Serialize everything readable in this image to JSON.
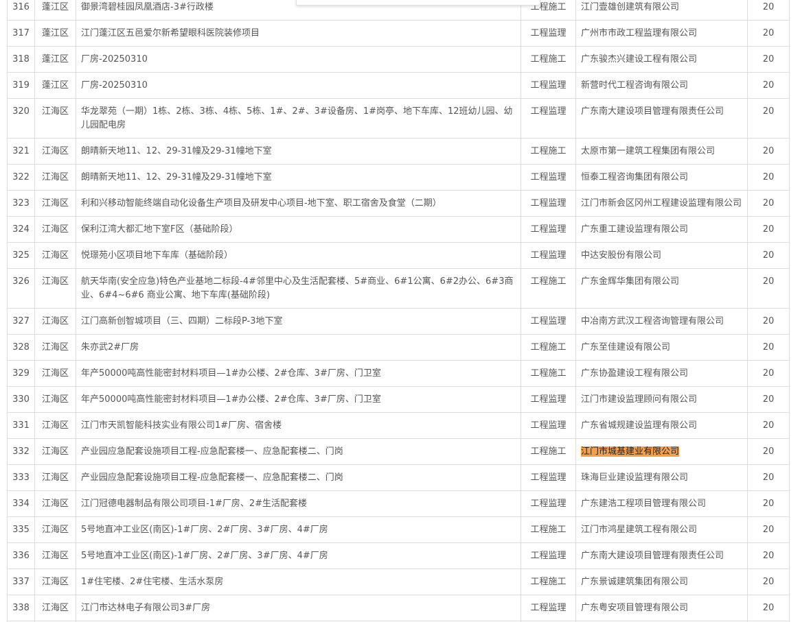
{
  "table": {
    "rows": [
      {
        "num": "316",
        "district": "蓬江区",
        "project": "御景湾碧桂园凤凰酒店-3#行政楼",
        "type": "工程施工",
        "company": "江门壹雄创建筑有限公司",
        "score": "20"
      },
      {
        "num": "317",
        "district": "蓬江区",
        "project": "江门蓬江区五邑爱尔新希望眼科医院装修项目",
        "type": "工程监理",
        "company": "广州市市政工程监理有限公司",
        "score": "20"
      },
      {
        "num": "318",
        "district": "蓬江区",
        "project": "厂房-20250310",
        "type": "工程施工",
        "company": "广东骏杰兴建设工程有限公司",
        "score": "20"
      },
      {
        "num": "319",
        "district": "蓬江区",
        "project": "厂房-20250310",
        "type": "工程监理",
        "company": "新营时代工程咨询有限公司",
        "score": "20"
      },
      {
        "num": "320",
        "district": "江海区",
        "project": "华龙翠苑（一期）1栋、2栋、3栋、4栋、5栋、1#、2#、3#设备房、1#岗亭、地下车库、12班幼儿园、幼儿园配电房",
        "type": "工程监理",
        "company": "广东南大建设项目管理有限责任公司",
        "score": "20"
      },
      {
        "num": "321",
        "district": "江海区",
        "project": "朗晴新天地11、12、29-31幢及29-31幢地下室",
        "type": "工程施工",
        "company": "太原市第一建筑工程集团有限公司",
        "score": "20"
      },
      {
        "num": "322",
        "district": "江海区",
        "project": "朗晴新天地11、12、29-31幢及29-31幢地下室",
        "type": "工程监理",
        "company": "恒泰工程咨询集团有限公司",
        "score": "20"
      },
      {
        "num": "323",
        "district": "江海区",
        "project": "利和兴移动智能终端自动化设备生产项目及研发中心项目-地下室、职工宿舍及食堂（二期）",
        "type": "工程监理",
        "company": "江门市新会区冈州工程建设监理有限公司",
        "score": "20"
      },
      {
        "num": "324",
        "district": "江海区",
        "project": "保利江湾大都汇地下室F区（基础阶段）",
        "type": "工程监理",
        "company": "广东重工建设监理有限公司",
        "score": "20"
      },
      {
        "num": "325",
        "district": "江海区",
        "project": "悦璟苑小区项目地下车库（基础阶段）",
        "type": "工程监理",
        "company": "中达安股份有限公司",
        "score": "20"
      },
      {
        "num": "326",
        "district": "江海区",
        "project": "航天华南(安全应急)特色产业基地二标段-4#邻里中心及生活配套楼、5#商业、6#1公寓、6#2办公、6#3商业、6#4~6#6 商业公寓、地下车库(基础阶段)",
        "type": "工程施工",
        "company": "广东金辉华集团有限公司",
        "score": "20"
      },
      {
        "num": "327",
        "district": "江海区",
        "project": "江门高新创智城项目（三、四期）二标段P-3地下室",
        "type": "工程监理",
        "company": "中冶南方武汉工程咨询管理有限公司",
        "score": "20"
      },
      {
        "num": "328",
        "district": "江海区",
        "project": "朱亦武2#厂房",
        "type": "工程施工",
        "company": "广东至佳建设有限公司",
        "score": "20"
      },
      {
        "num": "329",
        "district": "江海区",
        "project": "年产50000吨高性能密封材料项目—1#办公楼、2#仓库、3#厂房、门卫室",
        "type": "工程施工",
        "company": "广东协盈建设工程有限公司",
        "score": "20"
      },
      {
        "num": "330",
        "district": "江海区",
        "project": "年产50000吨高性能密封材料项目—1#办公楼、2#仓库、3#厂房、门卫室",
        "type": "工程监理",
        "company": "江门市建设监理顾问有限公司",
        "score": "20"
      },
      {
        "num": "331",
        "district": "江海区",
        "project": "江门市天凯智能科技实业有限公司1#厂房、宿舍楼",
        "type": "工程监理",
        "company": "广东省城规建设监理有限公司",
        "score": "20"
      },
      {
        "num": "332",
        "district": "江海区",
        "project": "产业园应急配套设施项目工程-应急配套楼一、应急配套楼二、门岗",
        "type": "工程施工",
        "company": "江门市城基建业有限公司",
        "score": "20",
        "highlight": true
      },
      {
        "num": "333",
        "district": "江海区",
        "project": "产业园应急配套设施项目工程-应急配套楼一、应急配套楼二、门岗",
        "type": "工程监理",
        "company": "珠海巨业建设监理有限公司",
        "score": "20"
      },
      {
        "num": "334",
        "district": "江海区",
        "project": "江门冠德电器制品有限公司项目-1#厂房、2#生活配套楼",
        "type": "工程监理",
        "company": "广东建浩工程项目管理有限公司",
        "score": "20"
      },
      {
        "num": "335",
        "district": "江海区",
        "project": "5号地直冲工业区(南区)-1#厂房、2#厂房、3#厂房、4#厂房",
        "type": "工程施工",
        "company": "江门市鸿星建筑工程有限公司",
        "score": "20"
      },
      {
        "num": "336",
        "district": "江海区",
        "project": "5号地直冲工业区(南区)-1#厂房、2#厂房、3#厂房、4#厂房",
        "type": "工程监理",
        "company": "广东南大建设项目管理有限责任公司",
        "score": "20"
      },
      {
        "num": "337",
        "district": "江海区",
        "project": "1#住宅楼、2#住宅楼、生活水泵房",
        "type": "工程施工",
        "company": "广东景诚建筑集团有限公司",
        "score": "20"
      },
      {
        "num": "338",
        "district": "江海区",
        "project": "江门市达林电子有限公司3#厂房",
        "type": "工程监理",
        "company": "广东粤安项目管理有限公司",
        "score": "20"
      },
      {
        "num": "",
        "district": "",
        "project": "",
        "type": "",
        "company": "",
        "score": ""
      }
    ]
  }
}
